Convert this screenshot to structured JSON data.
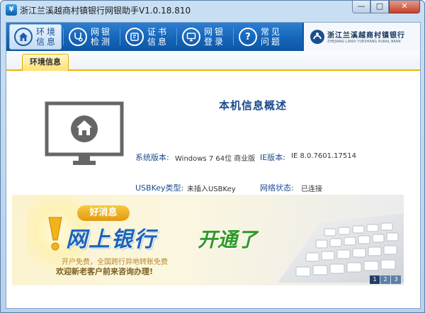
{
  "window": {
    "title": "浙江兰溪越商村镇银行网银助手V1.0.18.810",
    "app_icon": "bank-app-icon",
    "buttons": {
      "minimize": "—",
      "maximize": "□",
      "close": "✕"
    }
  },
  "nav": {
    "items": [
      {
        "label": "环境信息",
        "icon": "home-icon",
        "active": true
      },
      {
        "label": "网银检测",
        "icon": "stethoscope-icon",
        "active": false
      },
      {
        "label": "证书信息",
        "icon": "certificate-icon",
        "active": false
      },
      {
        "label": "网银登录",
        "icon": "monitor-icon",
        "active": false
      },
      {
        "label": "常见问题",
        "icon": "question-icon",
        "active": false
      }
    ]
  },
  "bank": {
    "name_cn": "浙江兰溪越商村镇银行",
    "name_en": "ZHEJIANG LANXI YUESHANG RURAL BANK"
  },
  "tabs": [
    {
      "label": "环境信息"
    }
  ],
  "info": {
    "title": "本机信息概述",
    "os_label": "系统版本:",
    "os_value": "Windows 7 64位 商业版",
    "ie_label": "IE版本:",
    "ie_value": "IE 8.0.7601.17514",
    "usbkey_label": "USBKey类型:",
    "usbkey_value": "未插入USBKey",
    "net_label": "网络状态:",
    "net_value": "已连接"
  },
  "banner": {
    "badge": "好消息",
    "headline": "网上银行",
    "headline2": "开通了",
    "sub1": "开户免费，全国跨行异地转账免费",
    "sub2": "欢迎新老客户前来咨询办理!",
    "pages": [
      "1",
      "2",
      "3"
    ],
    "active_page": "1"
  },
  "colors": {
    "nav_blue": "#1565b8",
    "title_blue": "#1c4a8e",
    "tab_yellow": "#ffe070",
    "headline_green": "#2f9a2a"
  }
}
